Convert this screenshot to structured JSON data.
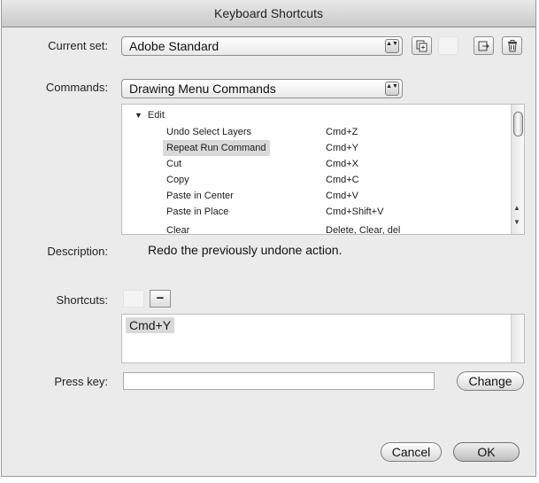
{
  "window": {
    "title": "Keyboard Shortcuts"
  },
  "current_set": {
    "label": "Current set:",
    "value": "Adobe Standard",
    "stepper": "▲▼",
    "buttons": [
      {
        "name": "duplicate-set-icon"
      },
      {
        "name": "rename-set-icon"
      },
      {
        "name": "export-set-icon"
      },
      {
        "name": "delete-set-icon"
      }
    ]
  },
  "commands": {
    "label": "Commands:",
    "value": "Drawing Menu Commands",
    "stepper": "▲▼",
    "group_toggle": "▼",
    "group": "Edit",
    "rows": [
      {
        "command": "Undo Select Layers",
        "shortcut": "Cmd+Z",
        "selected": false
      },
      {
        "command": "Repeat Run Command",
        "shortcut": "Cmd+Y",
        "selected": true
      },
      {
        "command": "Cut",
        "shortcut": "Cmd+X",
        "selected": false
      },
      {
        "command": "Copy",
        "shortcut": "Cmd+C",
        "selected": false
      },
      {
        "command": "Paste in Center",
        "shortcut": "Cmd+V",
        "selected": false
      },
      {
        "command": "Paste in Place",
        "shortcut": "Cmd+Shift+V",
        "selected": false
      },
      {
        "command": "Clear",
        "shortcut": "Delete, Clear, del",
        "selected": false
      }
    ],
    "scroll_up": "▲",
    "scroll_down": "▼"
  },
  "description": {
    "label": "Description:",
    "text": "Redo the previously undone action."
  },
  "shortcuts": {
    "label": "Shortcuts:",
    "add_label": "+",
    "remove_label": "−",
    "entries": [
      "Cmd+Y"
    ]
  },
  "press_key": {
    "label": "Press key:",
    "value": "",
    "change_label": "Change"
  },
  "footer": {
    "cancel_label": "Cancel",
    "ok_label": "OK"
  }
}
